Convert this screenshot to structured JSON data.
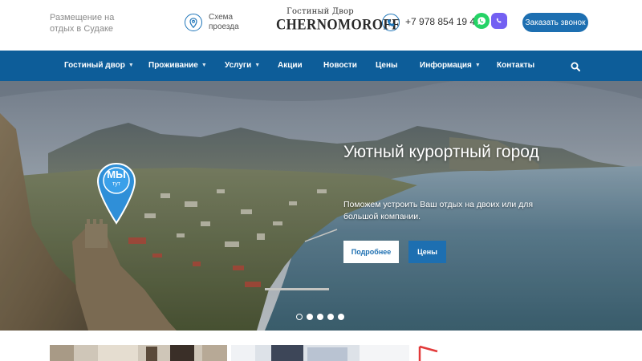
{
  "header": {
    "tagline": "Размещение на отдых в Судаке",
    "route_label": "Схема проезда",
    "logo_top": "Гостиный Двор",
    "logo_main": "CHERNOMOROFF",
    "phone": "+7 978 854 19 43",
    "call_button": "Заказать звонок"
  },
  "nav": {
    "items": [
      {
        "label": "Гостиный двор",
        "dropdown": true
      },
      {
        "label": "Проживание",
        "dropdown": true
      },
      {
        "label": "Услуги",
        "dropdown": true
      },
      {
        "label": "Акции",
        "dropdown": false
      },
      {
        "label": "Новости",
        "dropdown": false
      },
      {
        "label": "Цены",
        "dropdown": false
      },
      {
        "label": "Информация",
        "dropdown": true
      },
      {
        "label": "Контакты",
        "dropdown": false
      }
    ],
    "search_icon": "search-icon"
  },
  "hero": {
    "title": "Уютный курортный город",
    "subtitle": "Поможем устроить Ваш отдых на двоих или для большой компании.",
    "button_more": "Подробнее",
    "button_prices": "Цены",
    "pin_text_main": "МЫ",
    "pin_text_sub": "тут",
    "slides_count": 5,
    "active_slide": 1
  },
  "colors": {
    "brand_blue": "#1d6fb1",
    "nav_blue": "#0d5d99",
    "whatsapp_green": "#25d366",
    "viber_purple": "#7360f2"
  }
}
